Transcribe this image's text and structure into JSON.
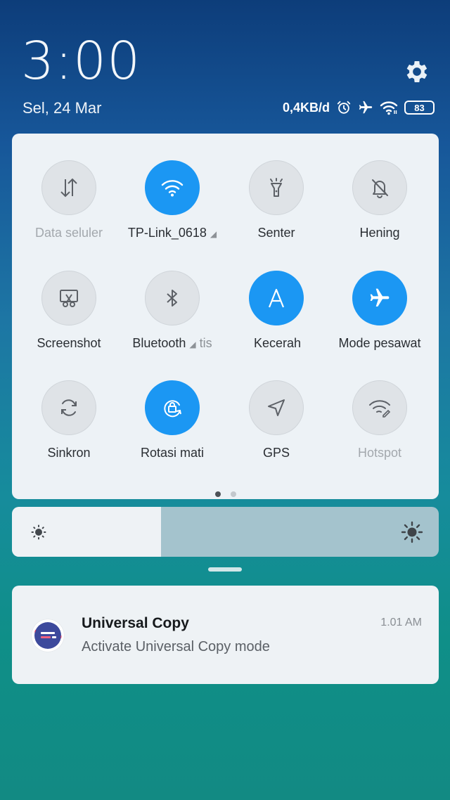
{
  "header": {
    "time": "3:00",
    "date": "Sel, 24 Mar",
    "network_speed": "0,4KB/d",
    "battery_level": "83"
  },
  "quick_settings": {
    "accent_color": "#1b97f3",
    "tiles": [
      {
        "label": "Data seluler",
        "state": "disabled",
        "icon": "data-arrows-icon"
      },
      {
        "label": "TP-Link_0618",
        "state": "on",
        "icon": "wifi-icon",
        "has_expand": true
      },
      {
        "label": "Senter",
        "state": "off",
        "icon": "flashlight-icon"
      },
      {
        "label": "Hening",
        "state": "off",
        "icon": "bell-off-icon"
      },
      {
        "label": "Screenshot",
        "state": "off",
        "icon": "scissors-icon"
      },
      {
        "label": "Bluetooth",
        "state": "off",
        "icon": "bluetooth-icon",
        "has_expand": true
      },
      {
        "label": "Kecerahan otomatis",
        "state": "on",
        "icon": "letter-a-icon"
      },
      {
        "label": "Mode pesawat",
        "state": "on",
        "icon": "airplane-icon"
      },
      {
        "label": "Sinkron",
        "state": "off",
        "icon": "sync-icon"
      },
      {
        "label": "Rotasi mati",
        "state": "on",
        "icon": "rotation-lock-icon"
      },
      {
        "label": "GPS",
        "state": "off",
        "icon": "location-arrow-icon"
      },
      {
        "label": "Hotspot",
        "state": "disabled",
        "icon": "hotspot-icon"
      }
    ],
    "overlap_fragment": "tis",
    "overlap_fragment_2": "Kecerah",
    "pages": {
      "count": 2,
      "active": 1
    }
  },
  "brightness": {
    "level": 0.35
  },
  "notification": {
    "app": "Universal Copy",
    "body": "Activate Universal Copy mode",
    "time": "1.01 AM"
  }
}
